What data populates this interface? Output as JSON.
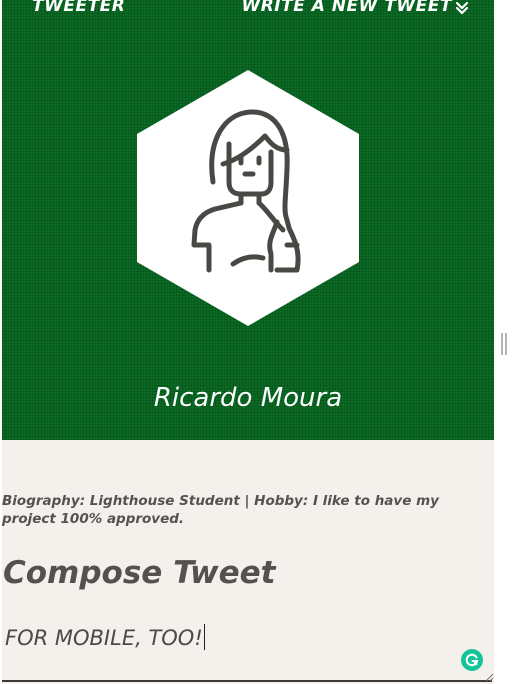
{
  "nav": {
    "brand": "TWEETER",
    "write_link": "WRITE A NEW TWEET",
    "write_icon": "double-chevron-down-icon"
  },
  "profile": {
    "avatar_icon": "woman-avatar-icon",
    "name": "Ricardo Moura",
    "bio": "Biography: Lighthouse Student | Hobby: I like to have my project 100% approved."
  },
  "compose": {
    "title": "Compose Tweet",
    "input_value": "FOR MOBILE, TOO!",
    "assistant_icon": "grammarly-icon"
  },
  "colors": {
    "header_green": "#0a6b24",
    "page_bg": "#f4f1ec",
    "text_gray": "#545250",
    "grammarly_green": "#15c39a"
  }
}
